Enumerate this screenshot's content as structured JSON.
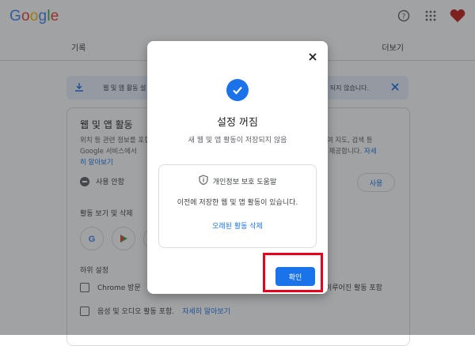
{
  "header": {
    "logo_letters": [
      "G",
      "o",
      "o",
      "g",
      "l",
      "e"
    ],
    "logo_colors": [
      "#4285f4",
      "#ea4335",
      "#fbbc05",
      "#4285f4",
      "#34a853",
      "#ea4335"
    ],
    "icons": [
      "help-icon",
      "apps-icon",
      "heart-avatar-icon"
    ]
  },
  "nav": {
    "left_tab": "기록",
    "right_tab": "더보기"
  },
  "banner": {
    "text_left": "웹 및 앱 활동 설",
    "text_right": "되지 않습니다."
  },
  "card": {
    "title": "웹 및 앱 활동",
    "description": "위치 등 관련 정보를 포함해 Google 서비스에서의 활동을 저장하여 Google 서비스에서",
    "description_right": "하여 지도, 검색 등",
    "description_right2": "을 제공합니다.",
    "link_more_right": "자세",
    "link_more": "히 알아보기",
    "status": "사용 안함",
    "use_button": "사용",
    "activity_section": "활동 보기 및 삭제",
    "sub_settings": "하위 설정",
    "chrome_option": "Chrome 방문",
    "chrome_option_right": "이루어진 활동 포함",
    "audio_option": "음성 및 오디오 활동 포함.",
    "audio_link": "자세히 알아보기"
  },
  "dialog": {
    "title": "설정 꺼짐",
    "subtitle": "새 웹 및 앱 활동이 저장되지 않음",
    "privacy_header": "개인정보 보호 도움말",
    "privacy_body": "이전에 저장한 웹 및 앱 활동이 있습니다.",
    "delete_link": "오래된 활동 삭제",
    "ok_button": "확인"
  },
  "colors": {
    "accent": "#1a73e8",
    "highlight": "#e8001c",
    "scrim": "rgba(32,33,36,0.42)"
  }
}
